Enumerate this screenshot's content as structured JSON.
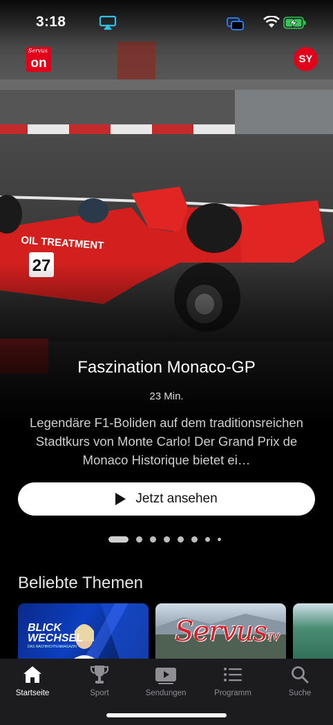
{
  "status_bar": {
    "time": "3:18"
  },
  "header": {
    "logo_small": "Servus",
    "logo_main": "on",
    "avatar_initials": "SY"
  },
  "hero": {
    "title": "Faszination Monaco-GP",
    "duration": "23 Min.",
    "description": "Legendäre F1-Boliden auf dem traditionsreichen Stadtkurs von Monte Carlo! Der Grand Prix de Monaco Historique bietet ei…",
    "watch_label": "Jetzt ansehen",
    "car_number": "27",
    "car_sponsor": "OIL TREATMENT",
    "pagination_count": 8,
    "pagination_active": 0
  },
  "section": {
    "title": "Beliebte Themen",
    "cards": [
      {
        "label_line1": "BLICK",
        "label_line2": "WECHSEL",
        "sub": "DAS NACHRICHTENMAGAZIN"
      },
      {
        "label": "Servus",
        "suffix": "TV"
      },
      {
        "label": ""
      }
    ]
  },
  "tabs": [
    {
      "label": "Startseite",
      "icon": "home-icon",
      "active": true
    },
    {
      "label": "Sport",
      "icon": "trophy-icon",
      "active": false
    },
    {
      "label": "Sendungen",
      "icon": "play-rect-icon",
      "active": false
    },
    {
      "label": "Programm",
      "icon": "list-icon",
      "active": false
    },
    {
      "label": "Suche",
      "icon": "search-icon",
      "active": false
    }
  ],
  "colors": {
    "brand_red": "#e3001b",
    "background": "#000000",
    "tabbar": "#1c1c1e"
  }
}
